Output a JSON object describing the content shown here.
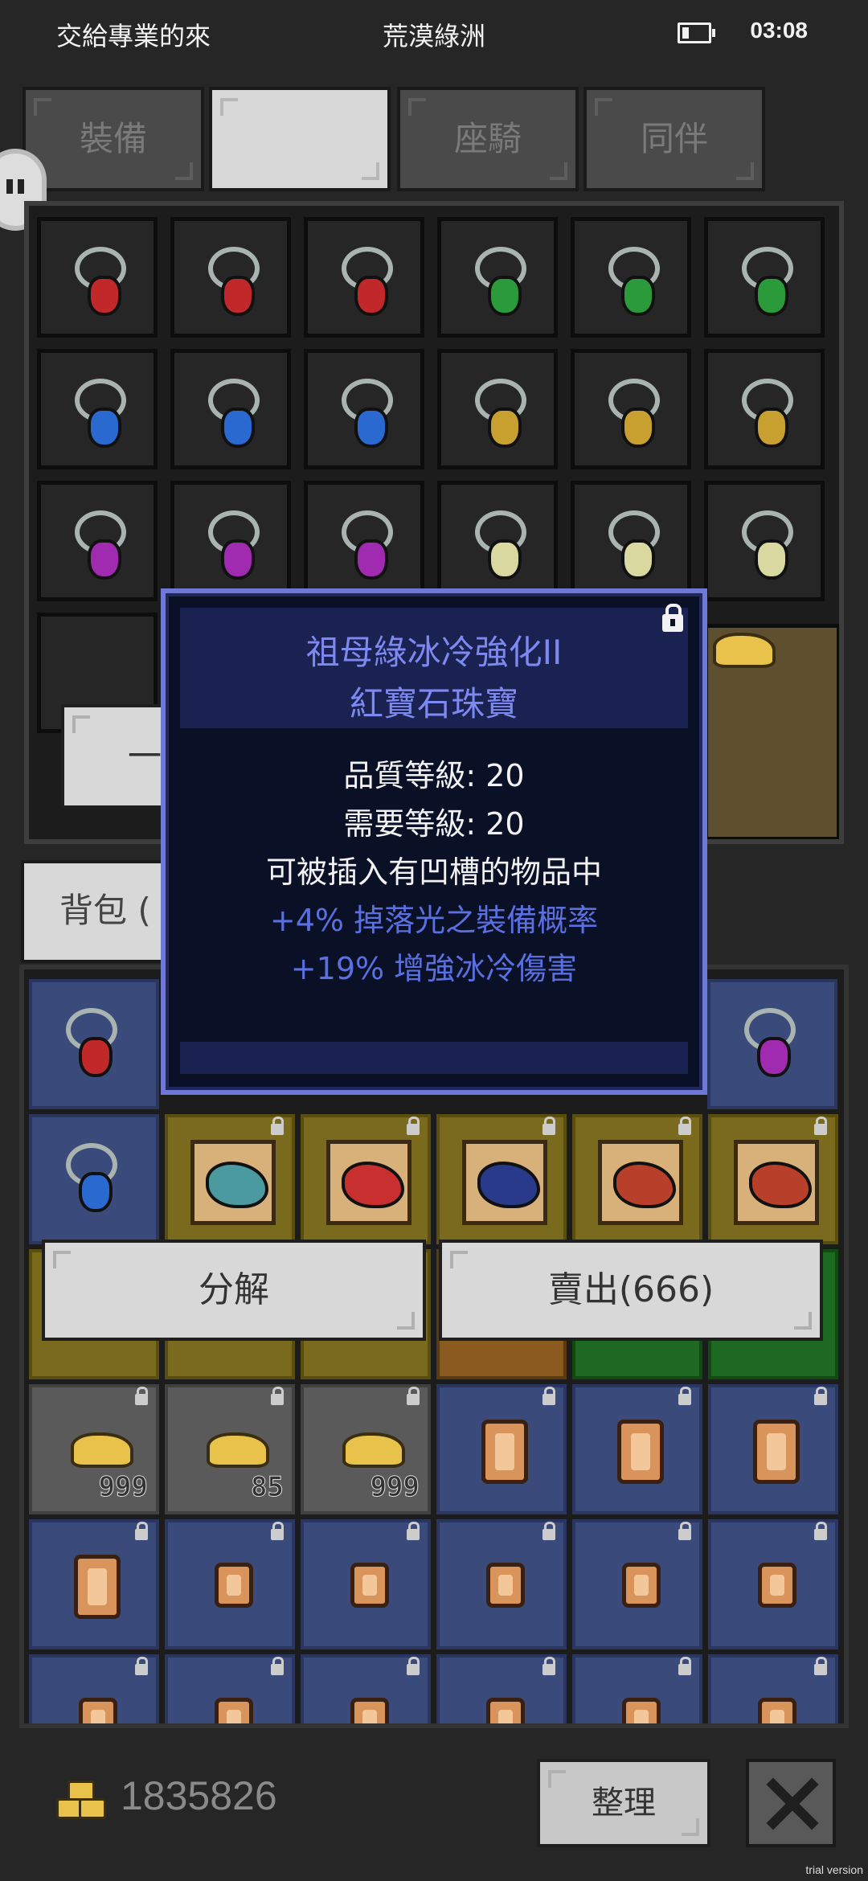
{
  "status_bar": {
    "left_text": "交給專業的來",
    "title": "荒漠綠洲",
    "time": "03:08"
  },
  "tabs": [
    {
      "label": "裝備"
    },
    {
      "label": ""
    },
    {
      "label": "座騎"
    },
    {
      "label": "同伴"
    }
  ],
  "equipment_grid": {
    "gem_colors": [
      "#c0282a",
      "#c0282a",
      "#c0282a",
      "#2a9a3a",
      "#2a9a3a",
      "#2a9a3a",
      "#2a6ad0",
      "#2a6ad0",
      "#2a6ad0",
      "#c8a030",
      "#c8a030",
      "#c8a030",
      "#a02ab0",
      "#a02ab0",
      "#a02ab0",
      "#d8d8a0",
      "#d8d8a0",
      "#d8d8a0"
    ],
    "partial_button_label": "一鍵"
  },
  "backpack": {
    "tab_label": "背包 ("
  },
  "tooltip": {
    "title_line1": "祖母綠冰冷強化II",
    "title_line2": "紅寶石珠寶",
    "quality_level": "品質等級: 20",
    "required_level": "需要等級: 20",
    "socket_note": "可被插入有凹槽的物品中",
    "bonus_1": "+4% 掉落光之裝備概率",
    "bonus_2": "+19% 增強冰冷傷害",
    "colors": {
      "title": "#7d88f0",
      "bonus": "#5a6fe0"
    }
  },
  "actions": {
    "disassemble_label": "分解",
    "sell_label": "賣出(666)"
  },
  "item_quantities": [
    "999",
    "85",
    "999"
  ],
  "footer": {
    "gold_amount": "1835826",
    "sort_label": "整理",
    "trial_label": "trial version"
  }
}
